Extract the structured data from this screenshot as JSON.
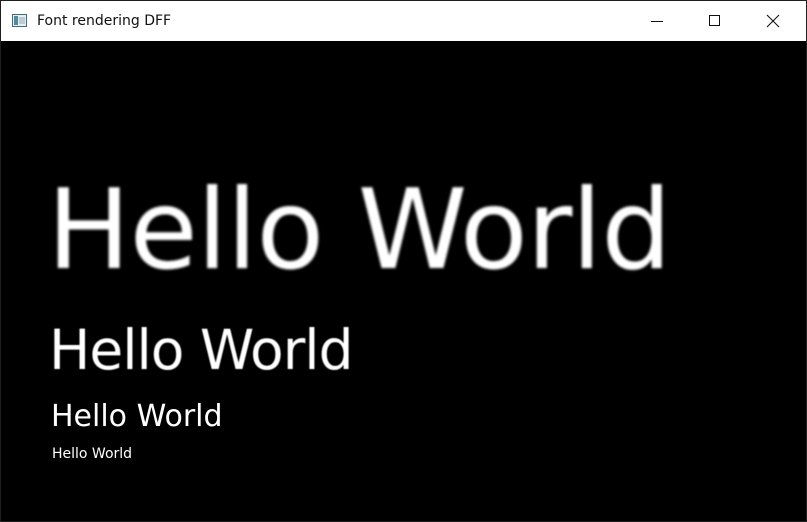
{
  "window": {
    "title": "Font rendering DFF"
  },
  "titlebar": {
    "icon": "app-window-icon",
    "buttons": [
      {
        "name": "minimize",
        "icon": "minimize-icon"
      },
      {
        "name": "maximize",
        "icon": "maximize-icon"
      },
      {
        "name": "close",
        "icon": "close-icon"
      }
    ]
  },
  "content": {
    "background": "#000000",
    "text_color": "#ffffff",
    "samples": [
      {
        "text": "Hello World"
      },
      {
        "text": "Hello World"
      },
      {
        "text": "Hello World"
      },
      {
        "text": "Hello World"
      }
    ]
  }
}
